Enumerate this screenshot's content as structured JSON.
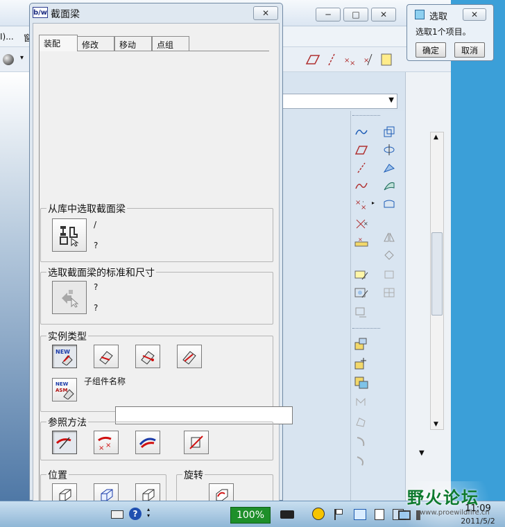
{
  "background_app": {
    "menu_fragment": "I)...",
    "menu_fragment_2": "窗"
  },
  "selection_popup": {
    "title": "选取",
    "message": "选取1个项目。",
    "ok_label": "确定",
    "cancel_label": "取消"
  },
  "dialog": {
    "logo_text": "b/w",
    "title": "截面梁",
    "tabs": [
      {
        "label": "装配",
        "active": true
      },
      {
        "label": "修改",
        "active": false
      },
      {
        "label": "移动",
        "active": false
      },
      {
        "label": "点组",
        "active": false
      }
    ],
    "library_group": {
      "label": "从库中选取截面梁",
      "value_line1": "/",
      "value_line2": "?"
    },
    "standard_group": {
      "label": "选取截面梁的标准和尺寸",
      "value_line1": "?",
      "value_line2": "?"
    },
    "instance_group": {
      "label": "实例类型",
      "subname_label": "子组件名称",
      "subname_value": ""
    },
    "reference_group": {
      "label": "参照方法"
    },
    "position_group": {
      "label": "位置"
    },
    "rotation_group": {
      "label": "旋转"
    }
  },
  "taskbar": {
    "battery": "100%",
    "forum_name": "野火论坛",
    "forum_url": "www.proewildfire.cn",
    "time": "11:09",
    "date": "2011/5/2"
  },
  "colors": {
    "desktop": "#3b9fd8",
    "dialog_frame": "#dfe8f1",
    "battery_green": "#1e8f2a",
    "icon_red": "#d01010"
  }
}
